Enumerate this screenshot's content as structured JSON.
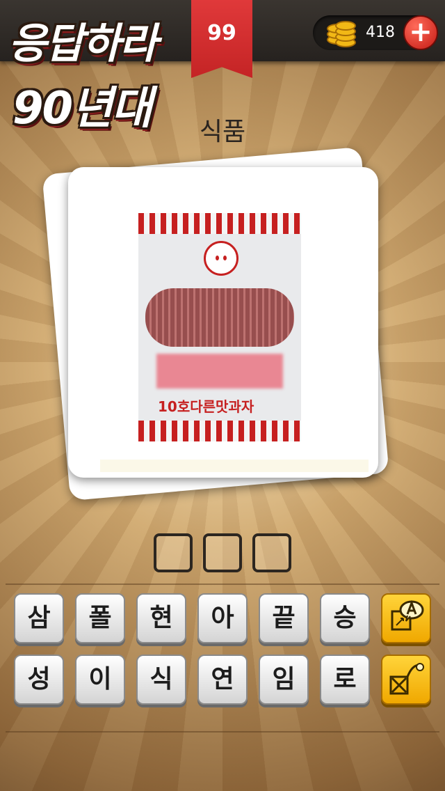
{
  "header": {
    "logo_line1": "응답하라",
    "logo_line2": "90년대",
    "level": "99",
    "coins": "418",
    "add_coins_symbol": "+"
  },
  "puzzle": {
    "category": "식품",
    "answer_length": 3,
    "package_text": "10호다른맛과자"
  },
  "keyboard": {
    "row1": [
      "삼",
      "폴",
      "현",
      "아",
      "끝",
      "승"
    ],
    "row2": [
      "성",
      "이",
      "식",
      "연",
      "임",
      "로"
    ]
  },
  "icons": {
    "coins": "coin-stack-icon",
    "add": "plus-icon",
    "hint_reveal": "reveal-letter-icon",
    "hint_remove": "remove-letters-icon"
  },
  "colors": {
    "ribbon": "#d12e2f",
    "hint_button": "#f5b800",
    "key_face": "#efefef"
  }
}
